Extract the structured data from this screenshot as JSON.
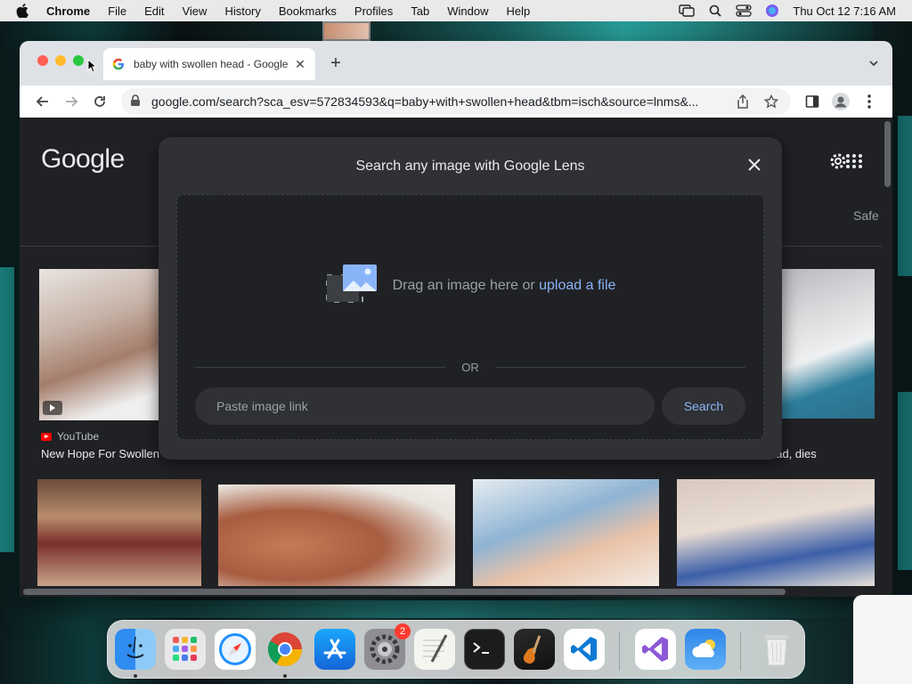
{
  "menubar": {
    "app": "Chrome",
    "items": [
      "File",
      "Edit",
      "View",
      "History",
      "Bookmarks",
      "Profiles",
      "Tab",
      "Window",
      "Help"
    ],
    "clock": "Thu Oct 12  7:16 AM"
  },
  "tab": {
    "title": "baby with swollen head - Google"
  },
  "address": {
    "url": "google.com/search?sca_esv=572834593&q=baby+with+swollen+head&tbm=isch&source=lnms&..."
  },
  "google": {
    "logo": "Google",
    "safe_label": "Safe"
  },
  "lens": {
    "title": "Search any image with Google Lens",
    "drag_text": "Drag an image here or",
    "upload_link": "upload a file",
    "or_label": "OR",
    "paste_placeholder": "Paste image link",
    "search_label": "Search"
  },
  "results": {
    "first": {
      "source": "YouTube",
      "title": "New Hope For Swollen"
    },
    "right_title": "ead, dies"
  },
  "dock": {
    "apps": [
      "finder-icon",
      "launchpad-icon",
      "safari-icon",
      "chrome-icon",
      "app-store-icon",
      "system-settings-icon",
      "textedit-icon",
      "terminal-icon",
      "garageband-icon",
      "vscode-icon",
      "visual-studio-icon",
      "weather-icon",
      "trash-icon"
    ],
    "settings_badge": "2"
  }
}
